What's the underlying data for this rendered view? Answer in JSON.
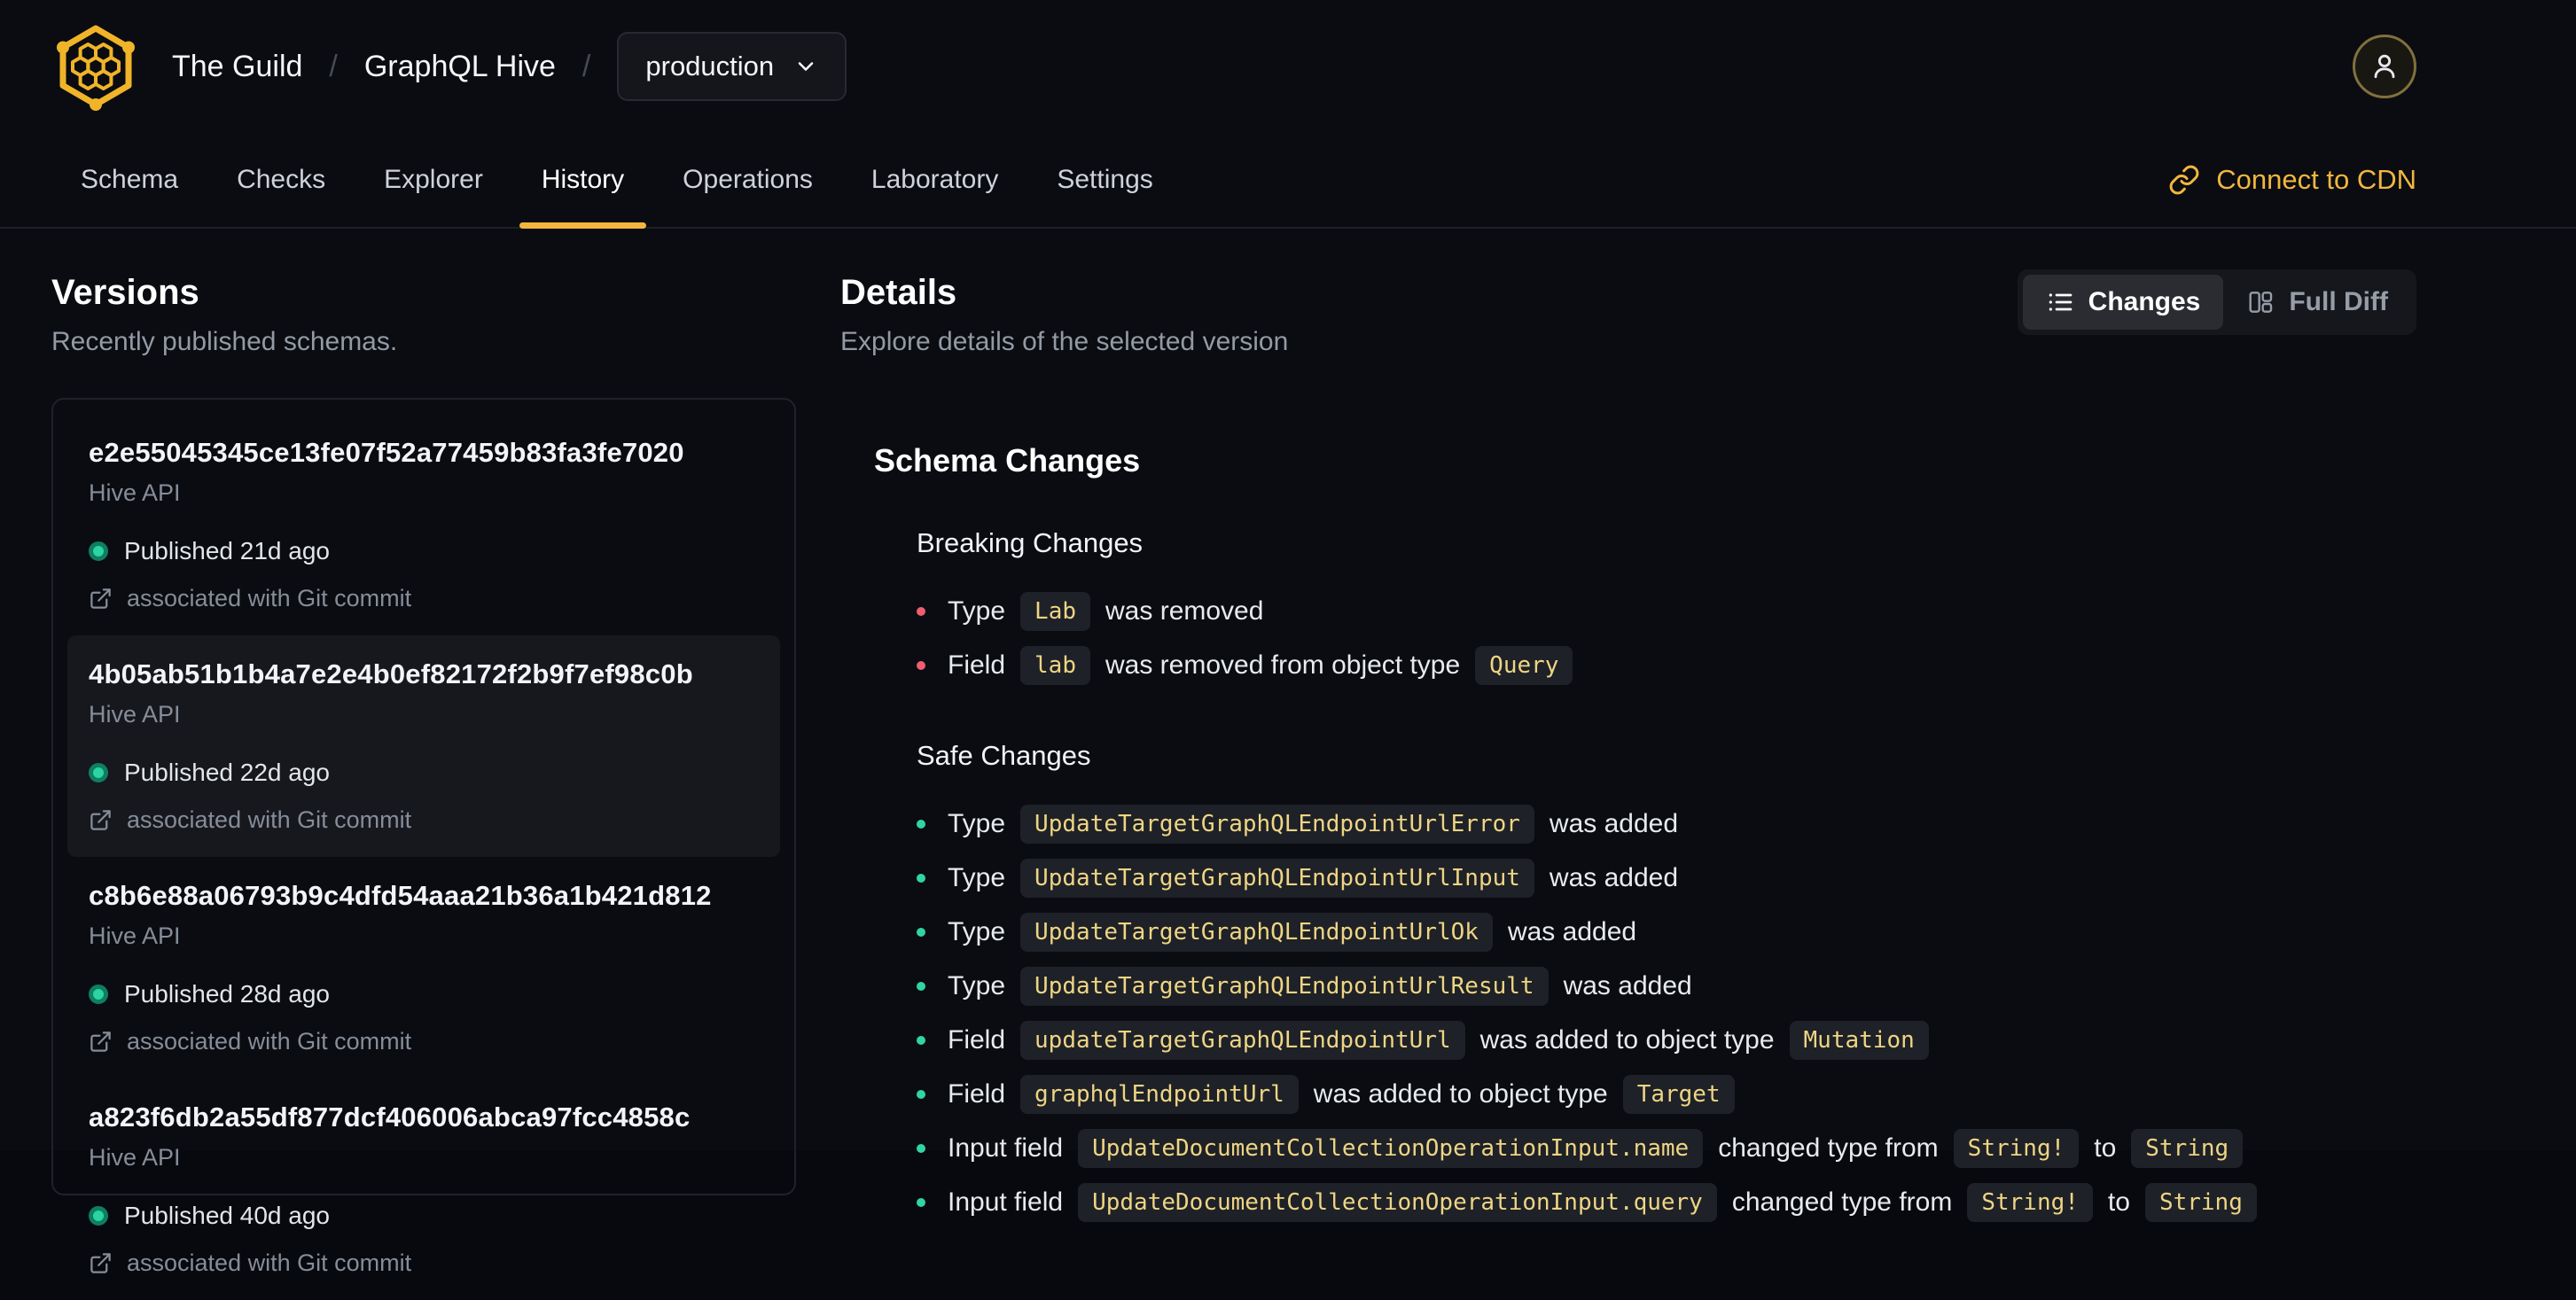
{
  "colors": {
    "accent": "#f2b63f",
    "breaking": "#ef5e70",
    "safe": "#30d5a0",
    "code": "#eed584"
  },
  "header": {
    "breadcrumb": {
      "org": "The Guild",
      "separator": "/",
      "project": "GraphQL Hive",
      "environment": "production"
    }
  },
  "nav": {
    "tabs": [
      {
        "label": "Schema",
        "active": false
      },
      {
        "label": "Checks",
        "active": false
      },
      {
        "label": "Explorer",
        "active": false
      },
      {
        "label": "History",
        "active": true
      },
      {
        "label": "Operations",
        "active": false
      },
      {
        "label": "Laboratory",
        "active": false
      },
      {
        "label": "Settings",
        "active": false
      }
    ],
    "cdn_link_label": "Connect to CDN"
  },
  "versions": {
    "title": "Versions",
    "subtitle": "Recently published schemas.",
    "items": [
      {
        "hash": "e2e55045345ce13fe07f52a77459b83fa3fe7020",
        "service": "Hive API",
        "published": "Published 21d ago",
        "git": "associated with Git commit",
        "selected": false
      },
      {
        "hash": "4b05ab51b1b4a7e2e4b0ef82172f2b9f7ef98c0b",
        "service": "Hive API",
        "published": "Published 22d ago",
        "git": "associated with Git commit",
        "selected": true
      },
      {
        "hash": "c8b6e88a06793b9c4dfd54aaa21b36a1b421d812",
        "service": "Hive API",
        "published": "Published 28d ago",
        "git": "associated with Git commit",
        "selected": false
      },
      {
        "hash": "a823f6db2a55df877dcf406006abca97fcc4858c",
        "service": "Hive API",
        "published": "Published 40d ago",
        "git": "associated with Git commit",
        "selected": false
      }
    ]
  },
  "details": {
    "title": "Details",
    "subtitle": "Explore details of the selected version",
    "view_toggle": {
      "changes_label": "Changes",
      "full_diff_label": "Full Diff",
      "active": "Changes"
    },
    "schema_changes": {
      "title": "Schema Changes",
      "breaking": {
        "title": "Breaking Changes",
        "items": [
          "Type `Lab` was removed",
          "Field `lab` was removed from object type `Query`"
        ]
      },
      "safe": {
        "title": "Safe Changes",
        "items": [
          "Type `UpdateTargetGraphQLEndpointUrlError` was added",
          "Type `UpdateTargetGraphQLEndpointUrlInput` was added",
          "Type `UpdateTargetGraphQLEndpointUrlOk` was added",
          "Type `UpdateTargetGraphQLEndpointUrlResult` was added",
          "Field `updateTargetGraphQLEndpointUrl` was added to object type `Mutation`",
          "Field `graphqlEndpointUrl` was added to object type `Target`",
          "Input field `UpdateDocumentCollectionOperationInput.name` changed type from `String!` to `String`",
          "Input field `UpdateDocumentCollectionOperationInput.query` changed type from `String!` to `String`"
        ]
      }
    }
  }
}
